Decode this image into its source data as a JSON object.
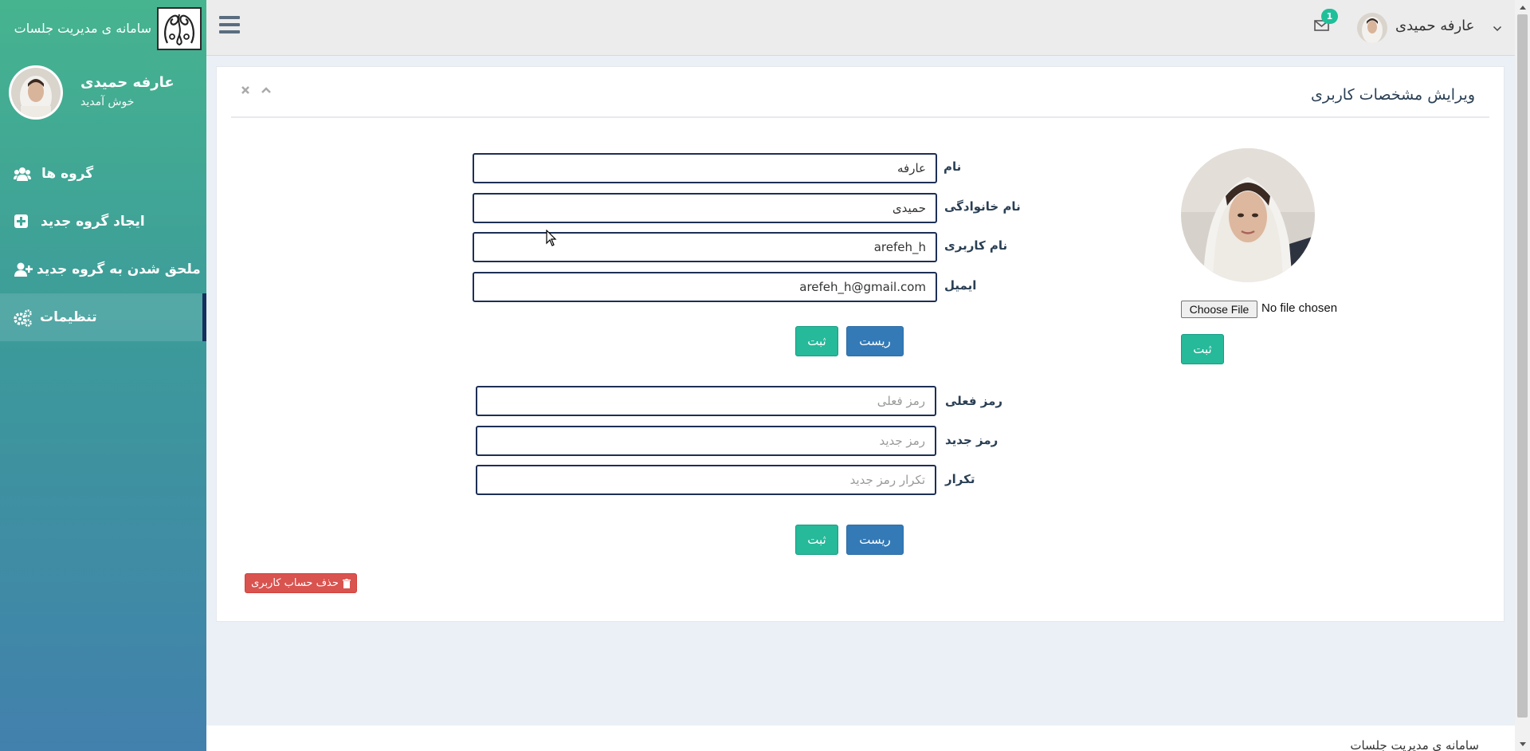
{
  "brand": {
    "title": "سامانه ی مدیریت جلسات",
    "logo_icon": "ornament-logo"
  },
  "profile": {
    "name": "عارفه حمیدی",
    "welcome": "خوش آمدید"
  },
  "nav": {
    "items": [
      {
        "label": "گروه ها",
        "icon": "users-icon"
      },
      {
        "label": "ایجاد گروه جدید",
        "icon": "plus-square-icon"
      },
      {
        "label": "ملحق شدن به گروه جدید",
        "icon": "user-plus-icon"
      },
      {
        "label": "تنظیمات",
        "icon": "gears-icon",
        "active": true
      }
    ]
  },
  "topbar": {
    "user_name": "عارفه حمیدی",
    "mail_count": "1"
  },
  "panel": {
    "title": "ویرایش مشخصات کاربری"
  },
  "profile_form": {
    "first_name_label": "نام",
    "first_name_value": "عارفه",
    "last_name_label": "نام خانوادگی",
    "last_name_value": "حمیدی",
    "username_label": "نام کاربری",
    "username_value": "arefeh_h",
    "email_label": "ایمیل",
    "email_value": "arefeh_h@gmail.com",
    "reset_label": "ریست",
    "submit_label": "ثبت"
  },
  "password_form": {
    "current_label": "رمز فعلی",
    "current_placeholder": "رمز فعلی",
    "new_label": "رمز جدید",
    "new_placeholder": "رمز جدید",
    "repeat_label": "تکرار",
    "repeat_placeholder": "تکرار رمز جدید",
    "reset_label": "ریست",
    "submit_label": "ثبت"
  },
  "photo_form": {
    "choose_file_label": "Choose File",
    "file_status": "No file chosen",
    "submit_label": "ثبت"
  },
  "delete_account_label": "حذف حساب کاربری",
  "footer": {
    "text": "سامانه ی مدیریت جلسات"
  },
  "colors": {
    "sidebar_top": "#46b48f",
    "sidebar_bottom": "#4280ad",
    "success": "#26b99a",
    "primary": "#337ab7",
    "danger": "#d9534f",
    "input_border": "#1d2f55"
  }
}
